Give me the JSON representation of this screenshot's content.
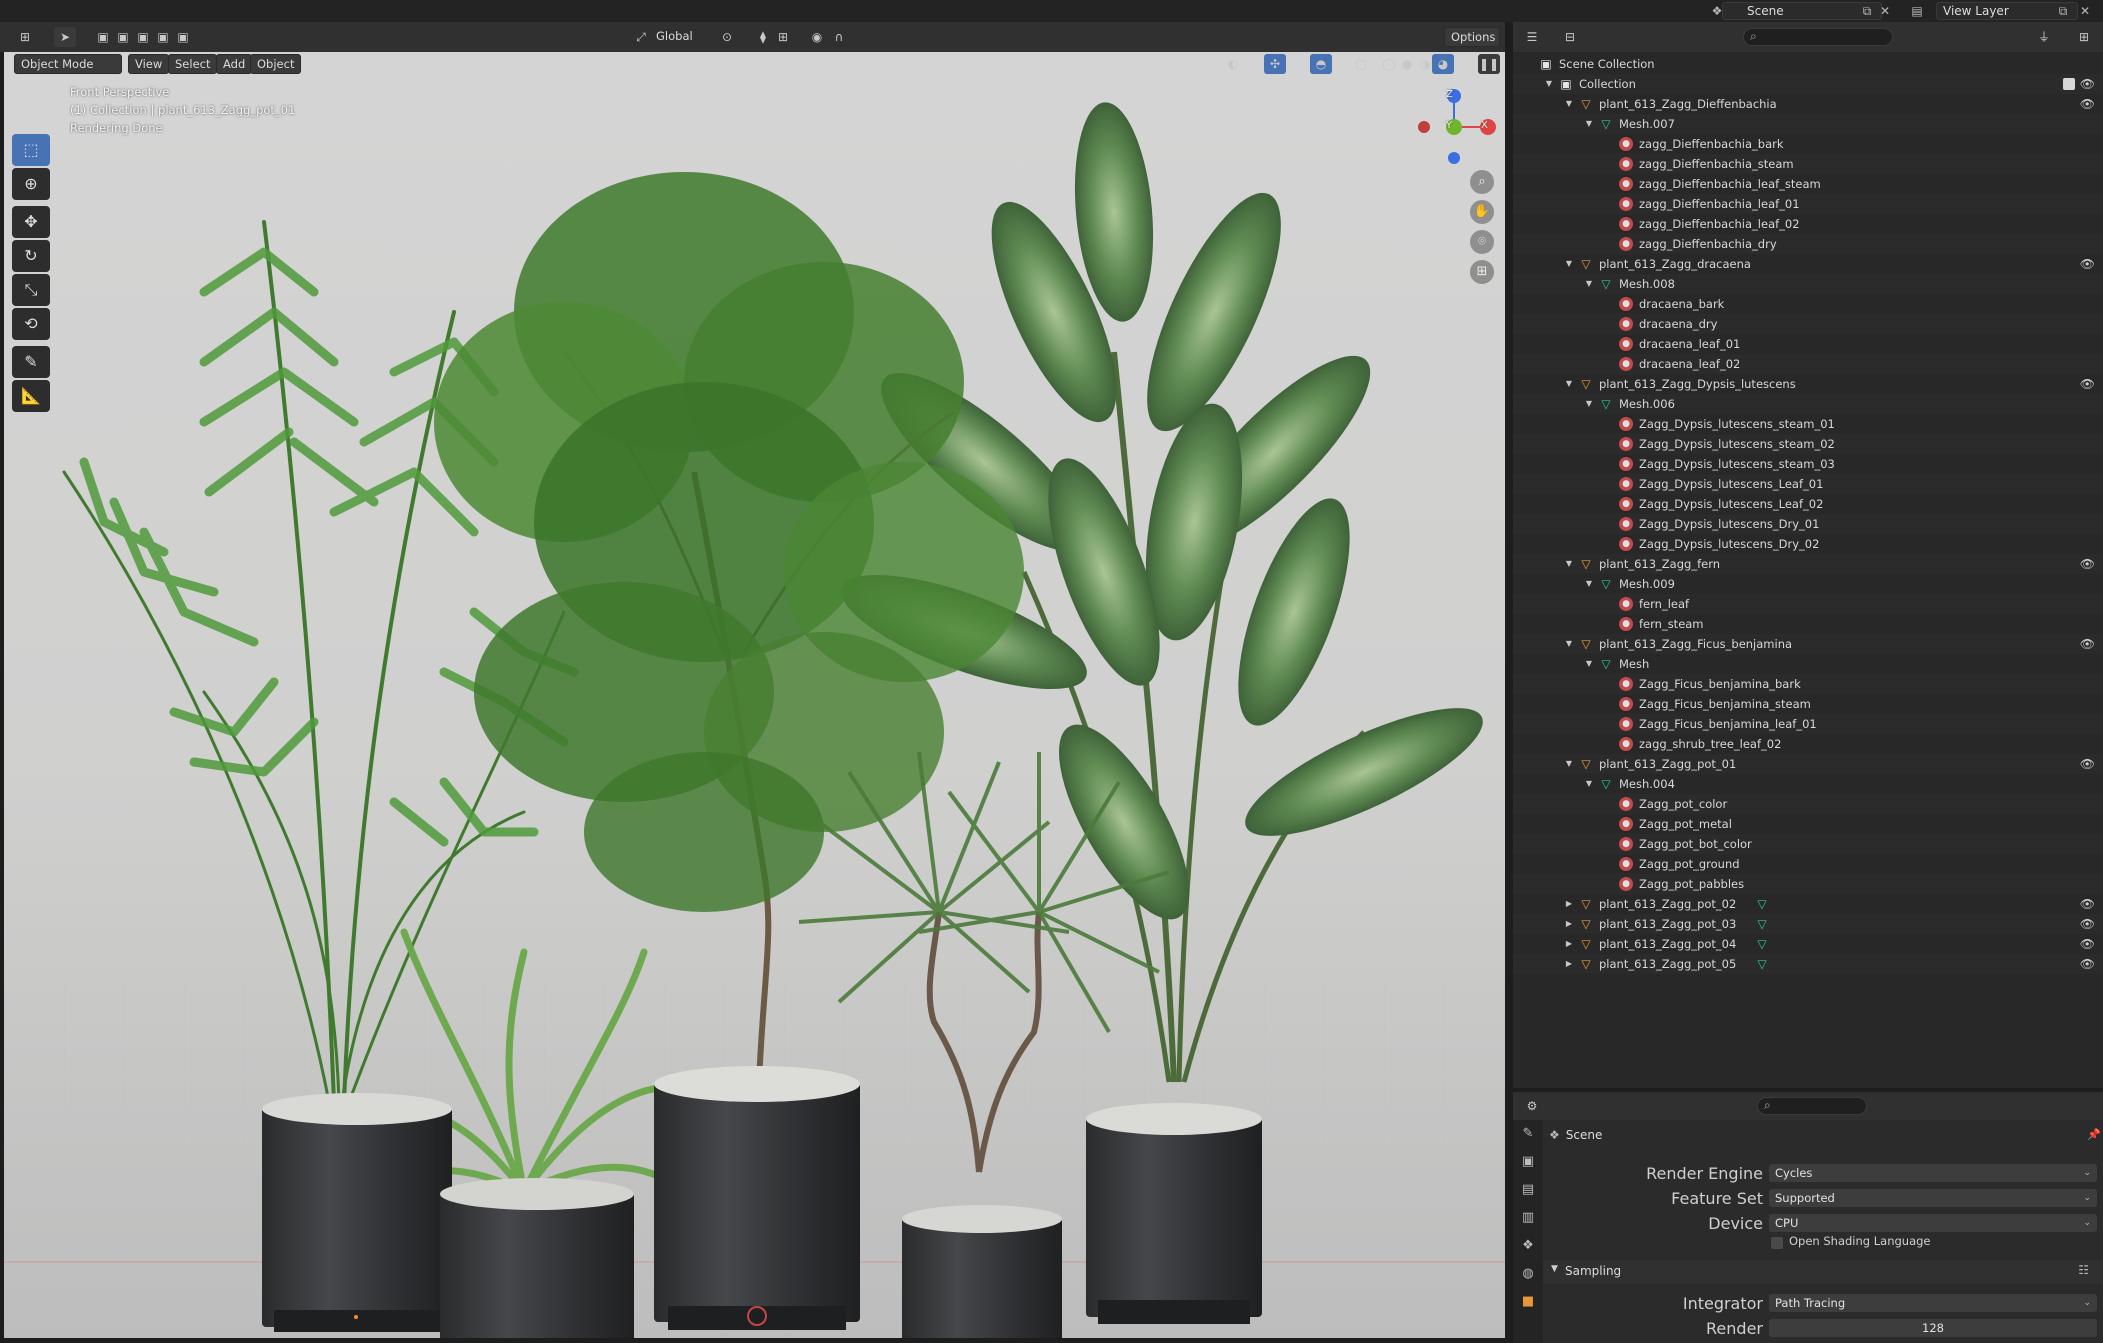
{
  "topbar": {
    "scene_field": "Scene",
    "view_layer_field": "View Layer"
  },
  "viewport_header": {
    "mode": "Object Mode",
    "menus": [
      "View",
      "Select",
      "Add",
      "Object"
    ],
    "orientation": "Global",
    "options": "Options"
  },
  "viewport_overlay": {
    "line1": "Front Perspective",
    "line2": "(1) Collection | plant_613_Zagg_pot_01",
    "line3": "Rendering Done"
  },
  "gizmo": {
    "z": "Z",
    "y": "Y",
    "x": "X"
  },
  "outliner": {
    "rows": [
      {
        "label": "Scene Collection",
        "indent": 0,
        "icon": "coll",
        "arrow": "",
        "eye": false
      },
      {
        "label": "Collection",
        "indent": 1,
        "icon": "coll",
        "arrow": "▼",
        "eye": true
      },
      {
        "label": "plant_613_Zagg_Dieffenbachia",
        "indent": 2,
        "icon": "obj",
        "arrow": "▼",
        "eye": true
      },
      {
        "label": "Mesh.007",
        "indent": 3,
        "icon": "mesh",
        "arrow": "▼",
        "eye": false
      },
      {
        "label": "zagg_Dieffenbachia_bark",
        "indent": 4,
        "icon": "mat",
        "arrow": "",
        "eye": false
      },
      {
        "label": "zagg_Dieffenbachia_steam",
        "indent": 4,
        "icon": "mat",
        "arrow": "",
        "eye": false
      },
      {
        "label": "zagg_Dieffenbachia_leaf_steam",
        "indent": 4,
        "icon": "mat",
        "arrow": "",
        "eye": false
      },
      {
        "label": "zagg_Dieffenbachia_leaf_01",
        "indent": 4,
        "icon": "mat",
        "arrow": "",
        "eye": false
      },
      {
        "label": "zagg_Dieffenbachia_leaf_02",
        "indent": 4,
        "icon": "mat",
        "arrow": "",
        "eye": false
      },
      {
        "label": "zagg_Dieffenbachia_dry",
        "indent": 4,
        "icon": "mat",
        "arrow": "",
        "eye": false
      },
      {
        "label": "plant_613_Zagg_dracaena",
        "indent": 2,
        "icon": "obj",
        "arrow": "▼",
        "eye": true
      },
      {
        "label": "Mesh.008",
        "indent": 3,
        "icon": "mesh",
        "arrow": "▼",
        "eye": false
      },
      {
        "label": "dracaena_bark",
        "indent": 4,
        "icon": "mat",
        "arrow": "",
        "eye": false
      },
      {
        "label": "dracaena_dry",
        "indent": 4,
        "icon": "mat",
        "arrow": "",
        "eye": false
      },
      {
        "label": "dracaena_leaf_01",
        "indent": 4,
        "icon": "mat",
        "arrow": "",
        "eye": false
      },
      {
        "label": "dracaena_leaf_02",
        "indent": 4,
        "icon": "mat",
        "arrow": "",
        "eye": false
      },
      {
        "label": "plant_613_Zagg_Dypsis_lutescens",
        "indent": 2,
        "icon": "obj",
        "arrow": "▼",
        "eye": true
      },
      {
        "label": "Mesh.006",
        "indent": 3,
        "icon": "mesh",
        "arrow": "▼",
        "eye": false
      },
      {
        "label": "Zagg_Dypsis_lutescens_steam_01",
        "indent": 4,
        "icon": "mat",
        "arrow": "",
        "eye": false
      },
      {
        "label": "Zagg_Dypsis_lutescens_steam_02",
        "indent": 4,
        "icon": "mat",
        "arrow": "",
        "eye": false
      },
      {
        "label": "Zagg_Dypsis_lutescens_steam_03",
        "indent": 4,
        "icon": "mat",
        "arrow": "",
        "eye": false
      },
      {
        "label": "Zagg_Dypsis_lutescens_Leaf_01",
        "indent": 4,
        "icon": "mat",
        "arrow": "",
        "eye": false
      },
      {
        "label": "Zagg_Dypsis_lutescens_Leaf_02",
        "indent": 4,
        "icon": "mat",
        "arrow": "",
        "eye": false
      },
      {
        "label": "Zagg_Dypsis_lutescens_Dry_01",
        "indent": 4,
        "icon": "mat",
        "arrow": "",
        "eye": false
      },
      {
        "label": "Zagg_Dypsis_lutescens_Dry_02",
        "indent": 4,
        "icon": "mat",
        "arrow": "",
        "eye": false
      },
      {
        "label": "plant_613_Zagg_fern",
        "indent": 2,
        "icon": "obj",
        "arrow": "▼",
        "eye": true
      },
      {
        "label": "Mesh.009",
        "indent": 3,
        "icon": "mesh",
        "arrow": "▼",
        "eye": false
      },
      {
        "label": "fern_leaf",
        "indent": 4,
        "icon": "mat",
        "arrow": "",
        "eye": false
      },
      {
        "label": "fern_steam",
        "indent": 4,
        "icon": "mat",
        "arrow": "",
        "eye": false
      },
      {
        "label": "plant_613_Zagg_Ficus_benjamina",
        "indent": 2,
        "icon": "obj",
        "arrow": "▼",
        "eye": true
      },
      {
        "label": "Mesh",
        "indent": 3,
        "icon": "mesh",
        "arrow": "▼",
        "eye": false
      },
      {
        "label": "Zagg_Ficus_benjamina_bark",
        "indent": 4,
        "icon": "mat",
        "arrow": "",
        "eye": false
      },
      {
        "label": "Zagg_Ficus_benjamina_steam",
        "indent": 4,
        "icon": "mat",
        "arrow": "",
        "eye": false
      },
      {
        "label": "Zagg_Ficus_benjamina_leaf_01",
        "indent": 4,
        "icon": "mat",
        "arrow": "",
        "eye": false
      },
      {
        "label": "zagg_shrub_tree_leaf_02",
        "indent": 4,
        "icon": "mat",
        "arrow": "",
        "eye": false
      },
      {
        "label": "plant_613_Zagg_pot_01",
        "indent": 2,
        "icon": "obj",
        "arrow": "▼",
        "eye": true
      },
      {
        "label": "Mesh.004",
        "indent": 3,
        "icon": "mesh",
        "arrow": "▼",
        "eye": false
      },
      {
        "label": "Zagg_pot_color",
        "indent": 4,
        "icon": "mat",
        "arrow": "",
        "eye": false
      },
      {
        "label": "Zagg_pot_metal",
        "indent": 4,
        "icon": "mat",
        "arrow": "",
        "eye": false
      },
      {
        "label": "Zagg_pot_bot_color",
        "indent": 4,
        "icon": "mat",
        "arrow": "",
        "eye": false
      },
      {
        "label": "Zagg_pot_ground",
        "indent": 4,
        "icon": "mat",
        "arrow": "",
        "eye": false
      },
      {
        "label": "Zagg_pot_pabbles",
        "indent": 4,
        "icon": "mat",
        "arrow": "",
        "eye": false
      },
      {
        "label": "plant_613_Zagg_pot_02",
        "indent": 2,
        "icon": "obj",
        "arrow": "▶",
        "eye": true
      },
      {
        "label": "plant_613_Zagg_pot_03",
        "indent": 2,
        "icon": "obj",
        "arrow": "▶",
        "eye": true
      },
      {
        "label": "plant_613_Zagg_pot_04",
        "indent": 2,
        "icon": "obj",
        "arrow": "▶",
        "eye": true
      },
      {
        "label": "plant_613_Zagg_pot_05",
        "indent": 2,
        "icon": "obj",
        "arrow": "▶",
        "eye": true
      }
    ]
  },
  "properties": {
    "context": "Scene",
    "render_engine_label": "Render Engine",
    "render_engine": "Cycles",
    "feature_set_label": "Feature Set",
    "feature_set": "Supported",
    "device_label": "Device",
    "device": "CPU",
    "osl_label": "Open Shading Language",
    "sampling_header": "Sampling",
    "integrator_label": "Integrator",
    "integrator": "Path Tracing",
    "render_label": "Render",
    "render_samples": "128"
  },
  "colors": {
    "accent": "#4772b3",
    "object_icon": "#e8973a",
    "mesh_icon": "#27c6a0",
    "material_icon": "#c24a4a"
  }
}
